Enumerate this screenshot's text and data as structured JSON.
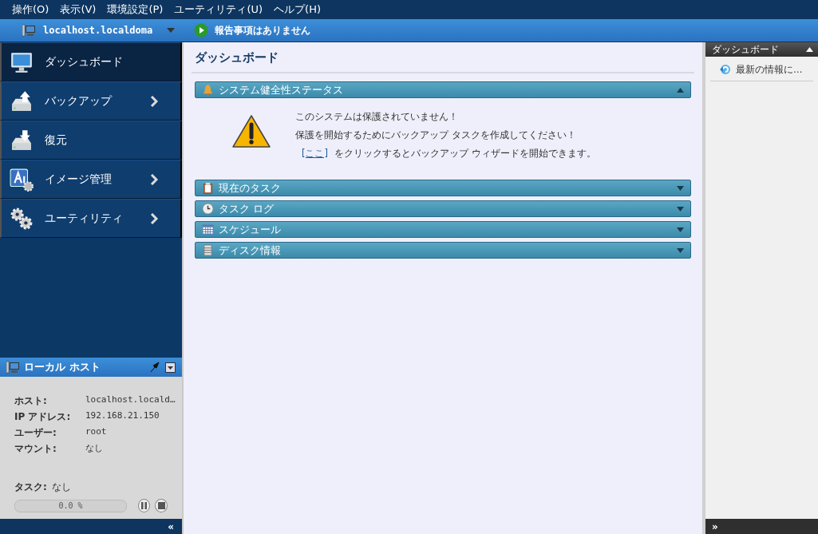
{
  "menu_bar": [
    {
      "label": "操作(O)"
    },
    {
      "label": "表示(V)"
    },
    {
      "label": "環境設定(P)"
    },
    {
      "label": "ユーティリティ(U)"
    },
    {
      "label": "ヘルプ(H)"
    }
  ],
  "toolbar": {
    "host": "localhost.localdoma",
    "status": "報告事項はありません"
  },
  "sidebar": {
    "items": [
      {
        "label": "ダッシュボード",
        "kind": "monitor",
        "selected": true,
        "has_submenu": false
      },
      {
        "label": "バックアップ",
        "kind": "backup",
        "selected": false,
        "has_submenu": true
      },
      {
        "label": "復元",
        "kind": "restore",
        "selected": false,
        "has_submenu": false
      },
      {
        "label": "イメージ管理",
        "kind": "image",
        "selected": false,
        "has_submenu": true
      },
      {
        "label": "ユーティリティ",
        "kind": "gears",
        "selected": false,
        "has_submenu": true
      }
    ]
  },
  "host_panel": {
    "title": "ローカル ホスト",
    "fields": [
      {
        "label": "ホスト:",
        "value": "localhost.locald…"
      },
      {
        "label": "IP アドレス:",
        "value": "192.168.21.150"
      },
      {
        "label": "ユーザー:",
        "value": "root"
      },
      {
        "label": "マウント:",
        "value": "なし"
      }
    ],
    "task_label": "タスク:",
    "task_value": "なし",
    "progress": {
      "level": 0,
      "reading": "0.0 %"
    },
    "collapse": "«"
  },
  "main": {
    "title": "ダッシュボード",
    "panels": [
      {
        "title": "システム健全性ステータス",
        "kind": "bell",
        "expanded": true,
        "lines": [
          "このシステムは保護されていません！",
          "保護を開始するためにバックアップ タスクを作成してください！"
        ],
        "link": "[ここ]",
        "link_after": "をクリックするとバックアップ ウィザードを開始できます。"
      },
      {
        "title": "現在のタスク",
        "kind": "clipboard",
        "expanded": false
      },
      {
        "title": "タスク ログ",
        "kind": "clock",
        "expanded": false
      },
      {
        "title": "スケジュール",
        "kind": "calendar",
        "expanded": false
      },
      {
        "title": "ディスク情報",
        "kind": "disk",
        "expanded": false
      }
    ]
  },
  "right_panel": {
    "title": "ダッシュボード",
    "expanded": true,
    "items": [
      {
        "label": "最新の情報に…"
      }
    ],
    "collapse": "»"
  }
}
